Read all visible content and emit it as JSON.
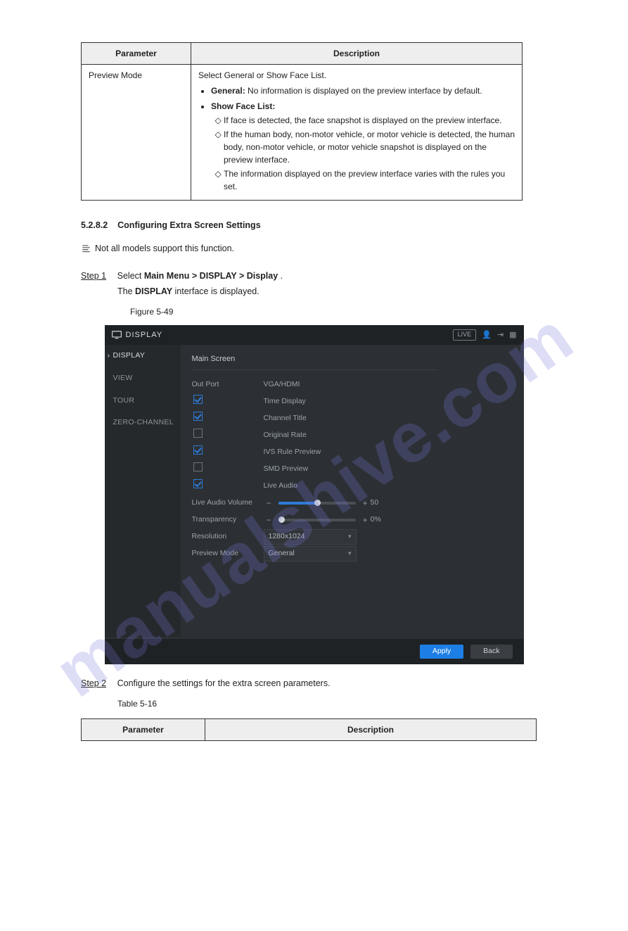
{
  "top_table": {
    "headers": [
      "Parameter",
      "Description"
    ],
    "row_param": "Preview Mode",
    "row_intro": "Select General or Show Face List.",
    "bullets": [
      {
        "head": "General:",
        "tail": " No information is displayed on the preview interface by default."
      },
      {
        "head": "Show Face List:",
        "tail": "",
        "sub": [
          "If face is detected, the face snapshot is displayed on the preview interface.",
          "If the human body, non-motor vehicle, or motor vehicle is detected, the human body, non-motor vehicle, or motor vehicle snapshot is displayed on the preview interface.",
          "The information displayed on the preview interface varies with the rules you set."
        ]
      }
    ]
  },
  "heading": {
    "num": "5.2.8.2",
    "title": "Configuring Extra Screen Settings"
  },
  "avail_note": "Not all models support this function.",
  "step1": {
    "num": "Step 1",
    "text_a": "Select ",
    "bold": "Main Menu > DISPLAY > Display",
    "text_b": "."
  },
  "step1_result_a": "The ",
  "step1_result_bold": "DISPLAY",
  "step1_result_b": " interface is displayed.",
  "figure_label": "Figure 5-49",
  "screenshot": {
    "app_title": "DISPLAY",
    "live_badge": "LIVE",
    "sidebar": [
      "DISPLAY",
      "VIEW",
      "TOUR",
      "ZERO-CHANNEL"
    ],
    "section": "Main Screen",
    "outport_label": "Out Port",
    "outport_value": "VGA/HDMI",
    "check_rows": [
      {
        "checked": true,
        "label": "Time Display"
      },
      {
        "checked": true,
        "label": "Channel Title"
      },
      {
        "checked": false,
        "label": "Original Rate"
      },
      {
        "checked": true,
        "label": "IVS Rule Preview"
      },
      {
        "checked": false,
        "label": "SMD Preview"
      },
      {
        "checked": true,
        "label": "Live Audio"
      }
    ],
    "vol": {
      "label": "Live Audio Volume",
      "value": "50",
      "pct": 50
    },
    "trans": {
      "label": "Transparency",
      "value": "0%",
      "pct": 4
    },
    "res": {
      "label": "Resolution",
      "value": "1280x1024"
    },
    "mode": {
      "label": "Preview Mode",
      "value": "General"
    },
    "apply": "Apply",
    "back": "Back"
  },
  "step2": {
    "num": "Step 2",
    "text": "Configure the settings for the extra screen parameters."
  },
  "table2_label": "Table 5-16",
  "table2_headers": [
    "Parameter",
    "Description"
  ],
  "watermark": "manualshive.com"
}
